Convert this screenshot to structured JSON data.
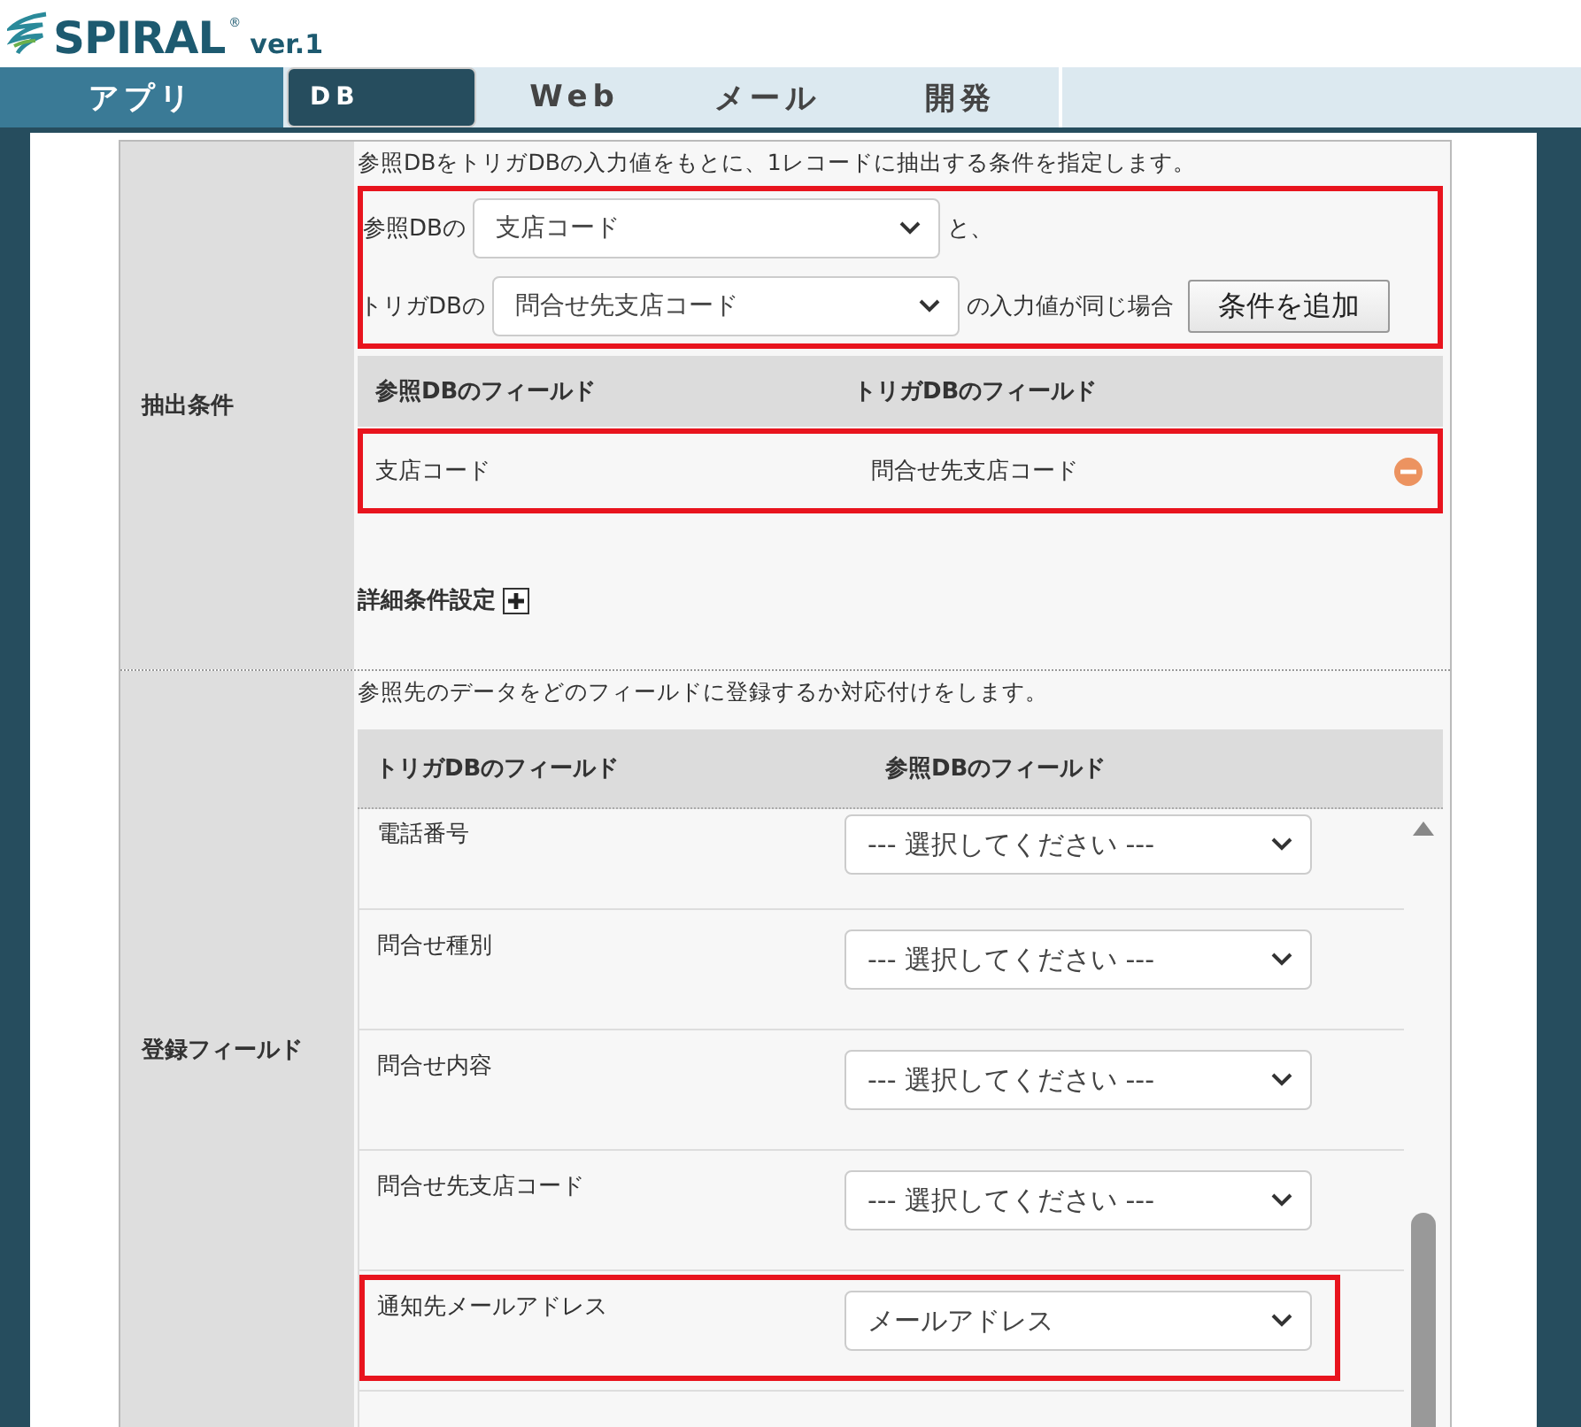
{
  "logo": {
    "name": "SPIRAL",
    "mark": "®",
    "version": "ver.1"
  },
  "tabs": [
    {
      "label": "アプリ",
      "selected": false,
      "hovered": true
    },
    {
      "label": "DB",
      "selected": true,
      "hovered": false
    },
    {
      "label": "Web",
      "selected": false,
      "hovered": false
    },
    {
      "label": "メール",
      "selected": false,
      "hovered": false
    },
    {
      "label": "開発",
      "selected": false,
      "hovered": false
    }
  ],
  "extraction": {
    "label": "抽出条件",
    "description": "参照DBをトリガDBの入力値をもとに、1レコードに抽出する条件を指定します。",
    "form_highlighted": true,
    "reference_prefix": "参照DBの",
    "reference_select": "支店コード",
    "reference_suffix": "と、",
    "trigger_prefix": "トリガDBの",
    "trigger_select": "問合せ先支店コード",
    "trigger_suffix": "の入力値が同じ場合",
    "add_button": "条件を追加",
    "columns": [
      "参照DBのフィールド",
      "トリガDBのフィールド"
    ],
    "rows": [
      {
        "reference_field": "支店コード",
        "trigger_field": "問合せ先支店コード",
        "highlighted": true
      }
    ],
    "detail_label": "詳細条件設定"
  },
  "registration": {
    "label": "登録フィールド",
    "description": "参照先のデータをどのフィールドに登録するか対応付けをします。",
    "columns": [
      "トリガDBのフィールド",
      "参照DBのフィールド"
    ],
    "rows": [
      {
        "field": "電話番号",
        "value": "--- 選択してください ---",
        "highlighted": false
      },
      {
        "field": "問合せ種別",
        "value": "--- 選択してください ---",
        "highlighted": false
      },
      {
        "field": "問合せ内容",
        "value": "--- 選択してください ---",
        "highlighted": false
      },
      {
        "field": "問合せ先支店コード",
        "value": "--- 選択してください ---",
        "highlighted": false
      },
      {
        "field": "通知先メールアドレス",
        "value": "メールアドレス",
        "highlighted": true
      }
    ]
  }
}
